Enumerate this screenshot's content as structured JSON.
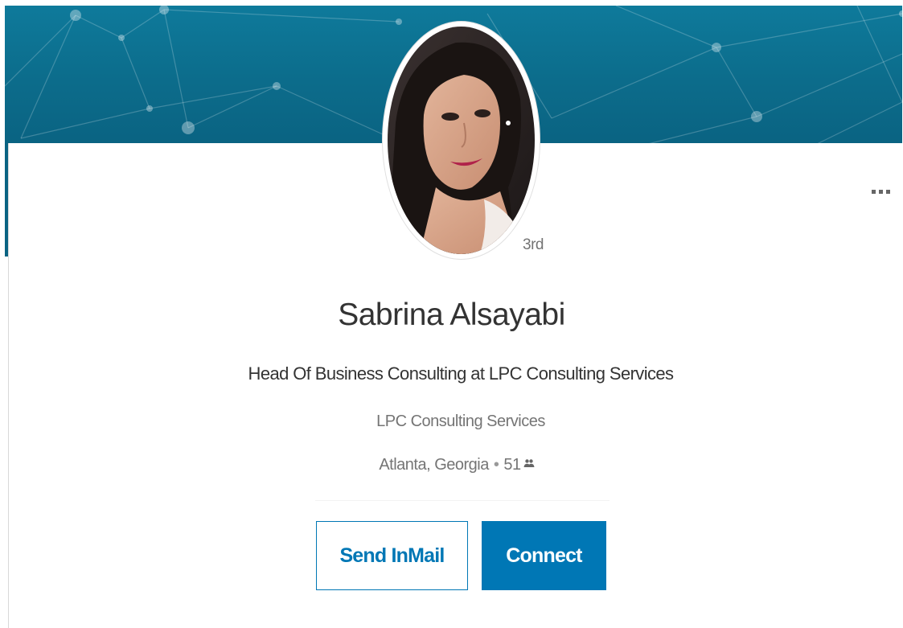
{
  "profile": {
    "name": "Sabrina Alsayabi",
    "headline": "Head Of Business Consulting at LPC Consulting Services",
    "company": "LPC Consulting Services",
    "location": "Atlanta, Georgia",
    "separator": "•",
    "connections": "51",
    "degree": "3rd"
  },
  "actions": {
    "send_inmail_label": "Send InMail",
    "connect_label": "Connect"
  },
  "icons": {
    "more": "more-options-icon",
    "connections": "connections-icon"
  },
  "colors": {
    "brand_blue": "#0077b5",
    "banner_teal": "#0c6c8b"
  }
}
